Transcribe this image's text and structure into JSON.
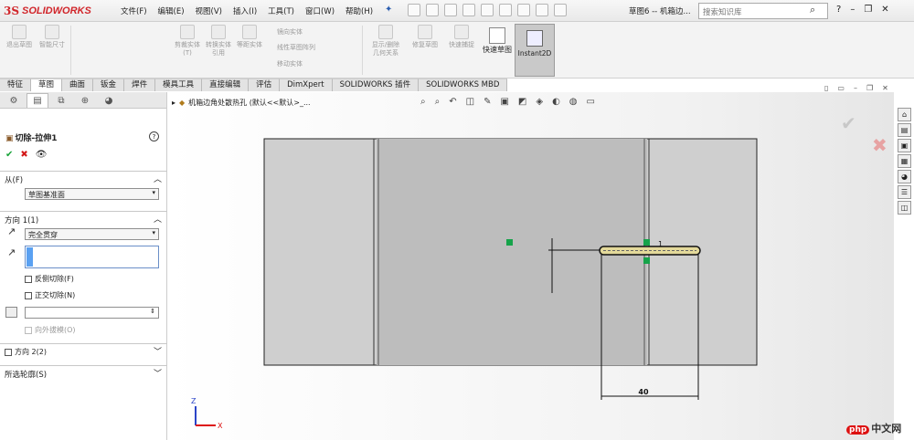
{
  "app": {
    "logo_mark": "3S",
    "logo_text": "SOLIDWORKS",
    "doc_title": "草图6 -- 机箱边...",
    "search_placeholder": "搜索知识库"
  },
  "menu": [
    "文件(F)",
    "编辑(E)",
    "视图(V)",
    "插入(I)",
    "工具(T)",
    "窗口(W)",
    "帮助(H)"
  ],
  "ribbon": {
    "buttons": [
      {
        "label": "退出草图"
      },
      {
        "label": "智能尺寸"
      },
      {
        "label": "剪裁实体(T)"
      },
      {
        "label": "转换实体引用"
      },
      {
        "label": "等距实体"
      },
      {
        "label": "显示/删除几何关系"
      },
      {
        "label": "修复草图"
      },
      {
        "label": "快速捕捉"
      }
    ],
    "small": [
      "镜向实体",
      "线性草图阵列",
      "移动实体"
    ],
    "quick_sketch": "快速草图",
    "instant2d": "Instant2D"
  },
  "tabs": [
    "特征",
    "草图",
    "曲面",
    "钣金",
    "焊件",
    "模具工具",
    "直接编辑",
    "评估",
    "DimXpert",
    "SOLIDWORKS 插件",
    "SOLIDWORKS MBD"
  ],
  "active_tab": "草图",
  "panel": {
    "feature_title": "切除-拉伸1",
    "from_label": "从(F)",
    "from_value": "草图基准面",
    "dir1_label": "方向 1(1)",
    "dir1_value": "完全贯穿",
    "flip_side": "反侧切除(F)",
    "normal_cut": "正交切除(N)",
    "draft_outward": "向外拔模(O)",
    "dir2_label": "方向 2(2)",
    "selected_contours": "所选轮廓(S)"
  },
  "graphics": {
    "breadcrumb": "机箱边角处散热孔  (默认<<默认>_...",
    "dim_value": "40",
    "relation_label": "1",
    "axis_z": "Z",
    "axis_x": "X"
  },
  "watermark": {
    "badge": "php",
    "text": "中文网"
  },
  "colors": {
    "accent": "#d1252a",
    "ok": "#19a33a",
    "cancel": "#d31919",
    "sketch_green": "#16a34a"
  }
}
